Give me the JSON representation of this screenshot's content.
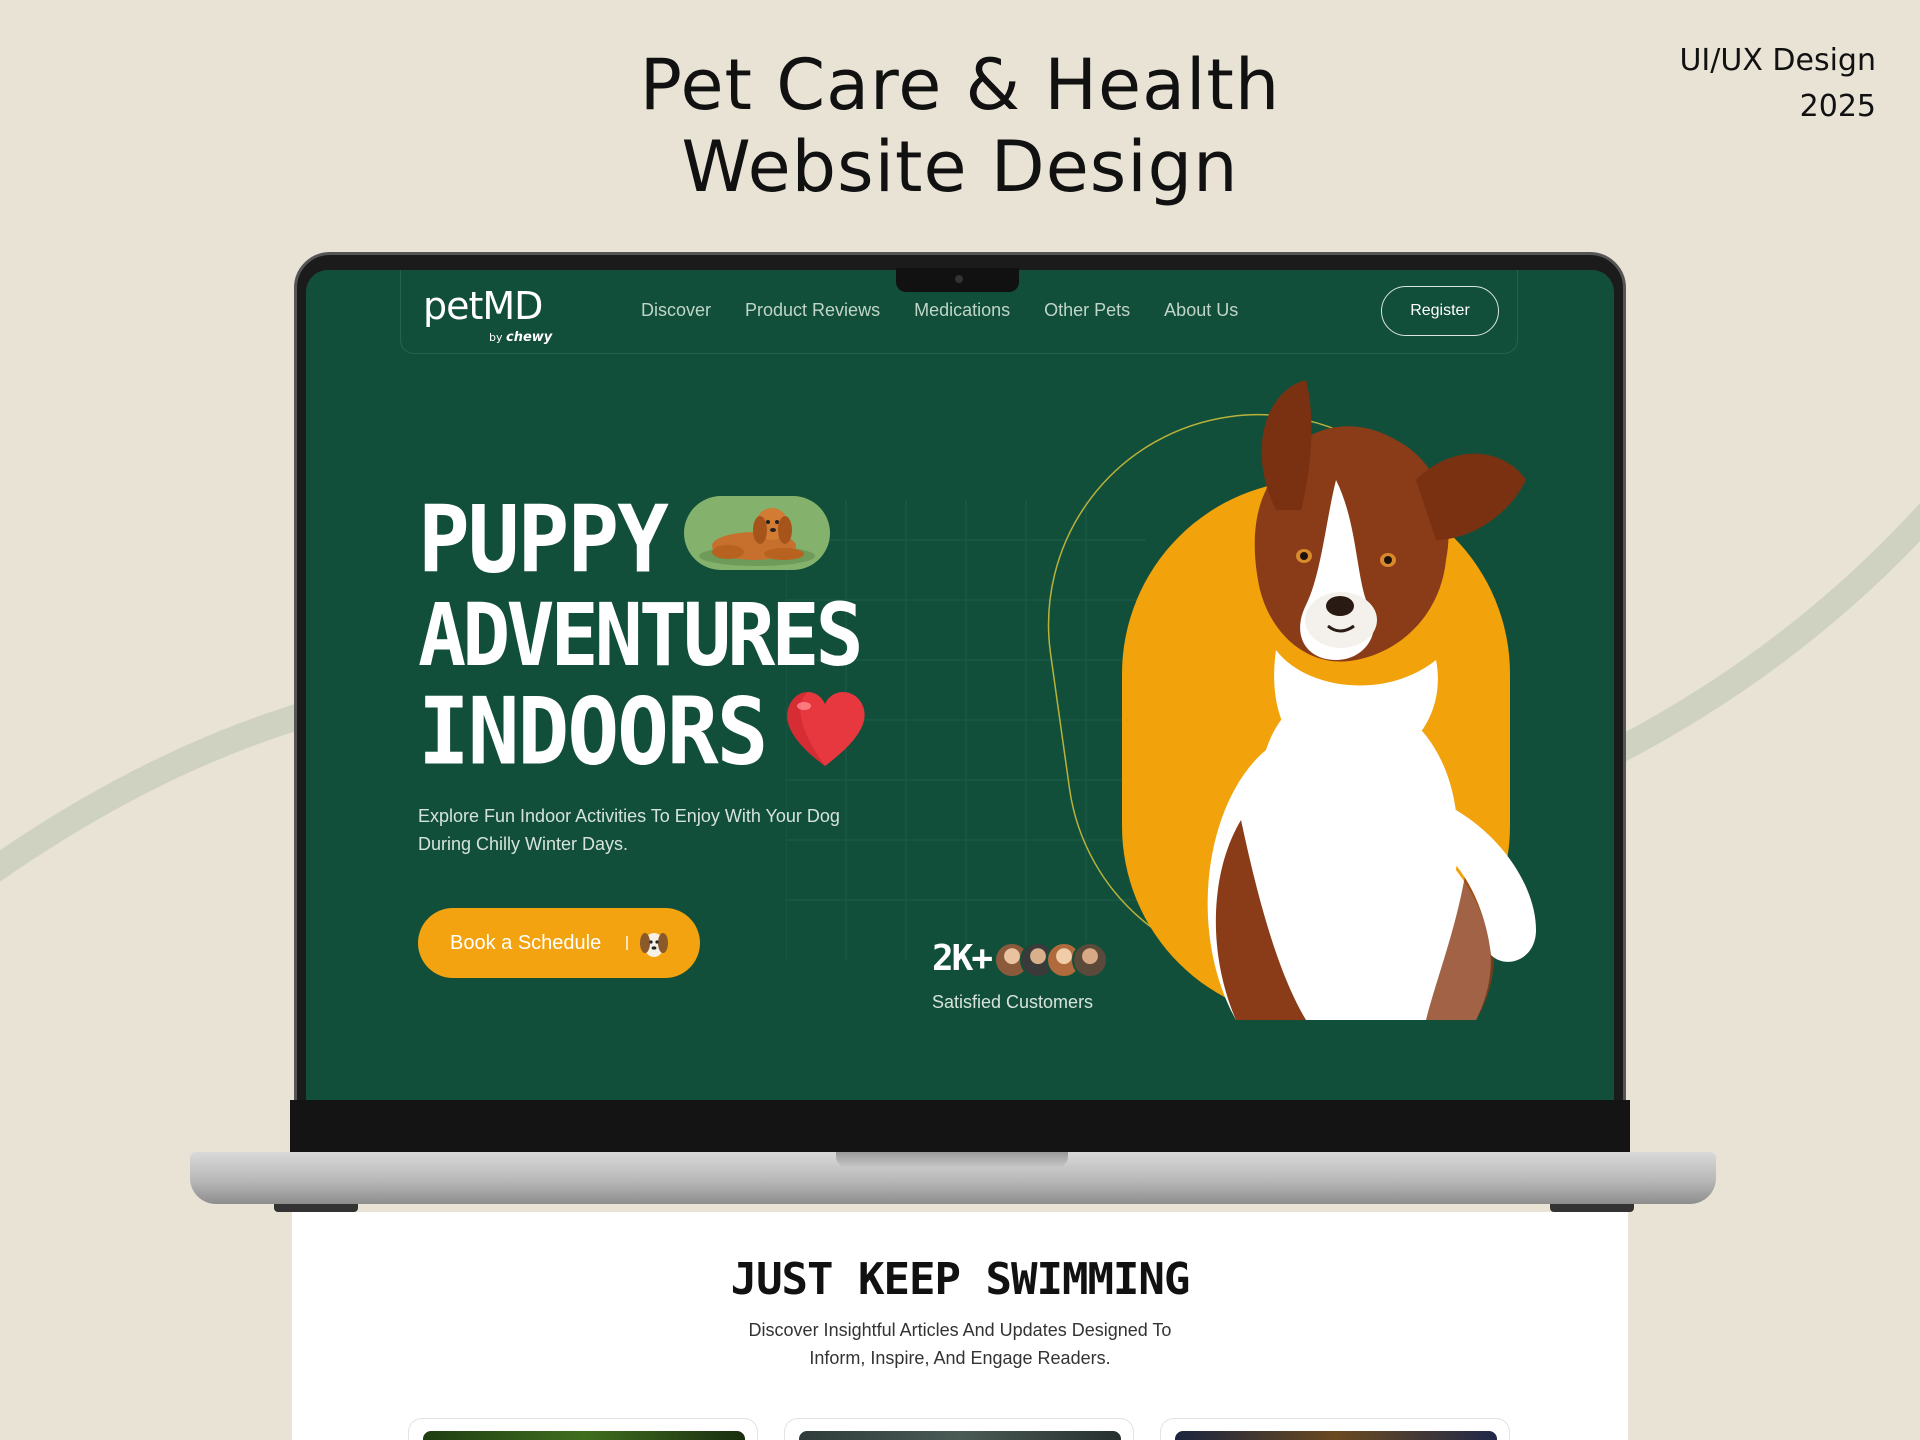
{
  "presentation": {
    "title_line1": "Pet Care & Health",
    "title_line2": "Website Design",
    "meta_line1": "UI/UX Design",
    "meta_line2": "2025"
  },
  "site": {
    "logo": {
      "main": "petMD",
      "by": "by",
      "brand": "chewy"
    },
    "nav": {
      "items": [
        {
          "label": "Discover"
        },
        {
          "label": "Product Reviews"
        },
        {
          "label": "Medications"
        },
        {
          "label": "Other Pets"
        },
        {
          "label": "About Us"
        }
      ],
      "register_label": "Register"
    },
    "hero": {
      "line1": "PUPPY",
      "line2": "ADVENTURES",
      "line3": "INDOORS",
      "description": "Explore Fun Indoor Activities To Enjoy With Your Dog During Chilly Winter Days.",
      "cta_label": "Book a Schedule"
    },
    "customers": {
      "count": "2K+",
      "label": "Satisfied Customers"
    },
    "section": {
      "title": "JUST KEEP SWIMMING",
      "desc_line1": "Discover Insightful Articles And Updates Designed To",
      "desc_line2": "Inform, Inspire, And Engage Readers."
    }
  },
  "colors": {
    "background": "#e9e3d6",
    "hero_green": "#124f3a",
    "accent_orange": "#f3a30f",
    "pill_green": "#84b26d",
    "heart_red": "#e8383f"
  },
  "icons": {
    "puppy_pill": "puppy-lying-icon",
    "heart": "heart-icon",
    "cta_dog": "dog-face-icon"
  }
}
